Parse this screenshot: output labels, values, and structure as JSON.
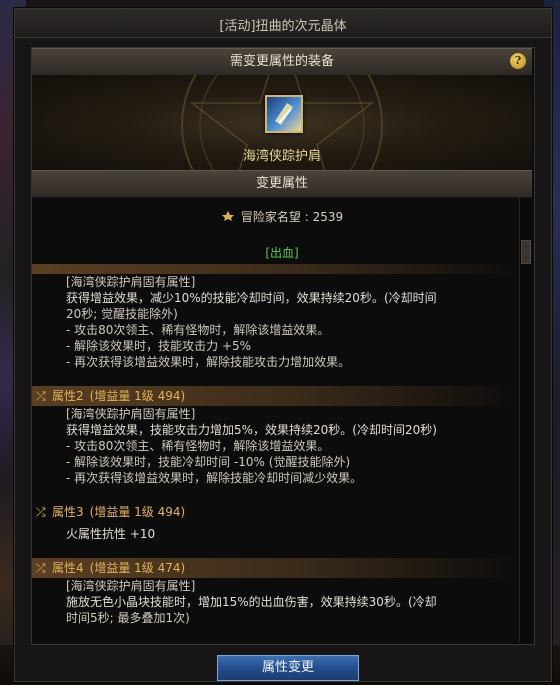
{
  "window": {
    "title": "[活动]扭曲的次元晶体"
  },
  "equip_section": {
    "header": "需变更属性的装备",
    "help": "?",
    "item_name": "海湾侠踪护肩"
  },
  "attr_section": {
    "header": "变更属性",
    "fame_label": "冒险家名望 : 2539",
    "bleed": "[出血]"
  },
  "attr1": {
    "tag": "[海湾侠踪护肩固有属性]",
    "lines": [
      "获得增益效果，减少10%的技能冷却时间，效果持续20秒。(冷却时间",
      "20秒; 觉醒技能除外)",
      "- 攻击80次领主、稀有怪物时，解除该增益效果。",
      "- 解除该效果时，技能攻击力 +5%",
      "- 再次获得该增益效果时，解除技能攻击力增加效果。"
    ]
  },
  "attr2": {
    "name": "属性2",
    "meta": "(增益量 1级 494)",
    "tag": "[海湾侠踪护肩固有属性]",
    "lines": [
      "获得增益效果，技能攻击力增加5%，效果持续20秒。(冷却时间20秒)",
      "- 攻击80次领主、稀有怪物时，解除该增益效果。",
      "- 解除该效果时，技能冷却时间 -10% (觉醒技能除外)",
      "- 再次获得该增益效果时，解除技能冷却时间减少效果。"
    ]
  },
  "attr3": {
    "name": "属性3",
    "meta": "(增益量 1级 494)",
    "lines": [
      "火属性抗性 +10"
    ]
  },
  "attr4": {
    "name": "属性4",
    "meta": "(增益量 1级 474)",
    "tag": "[海湾侠踪护肩固有属性]",
    "lines": [
      "施放无色小晶块技能时，增加15%的出血伤害，效果持续30秒。(冷却",
      "时间5秒; 最多叠加1次)"
    ]
  },
  "buttons": {
    "change": "属性变更"
  },
  "colors": {
    "gold": "#e3b25a",
    "bleed_green": "#56c958",
    "item_name": "#e9d98f",
    "button_blue": "#234e8e"
  },
  "icons": [
    "help-icon",
    "fame-icon",
    "shuffle-icon",
    "shoulder-armor-icon"
  ]
}
